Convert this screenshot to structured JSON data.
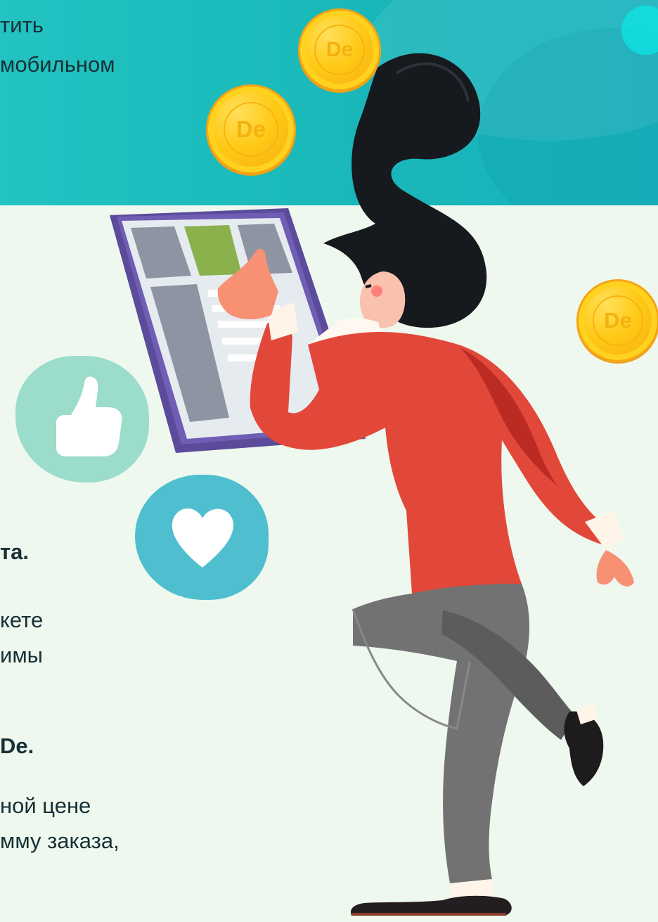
{
  "banner": {
    "text_line_1": "тить",
    "text_line_2": "мобильном"
  },
  "coins": {
    "label": "De"
  },
  "content": {
    "line_1": "та.",
    "line_2": "кете",
    "line_3": "имы",
    "line_4": "De.",
    "line_5": "ной цене",
    "line_6": "мму заказа,"
  },
  "colors": {
    "banner_teal": "#1fbcbd",
    "page_background": "#eef8ee",
    "coin_gold": "#ffc915",
    "like_bubble": "#9bdcca",
    "heart_bubble": "#4fbfd0",
    "shirt_red": "#e2483a"
  },
  "icons": {
    "like": "thumbs-up-icon",
    "heart": "heart-icon",
    "coin": "de-coin-icon"
  }
}
